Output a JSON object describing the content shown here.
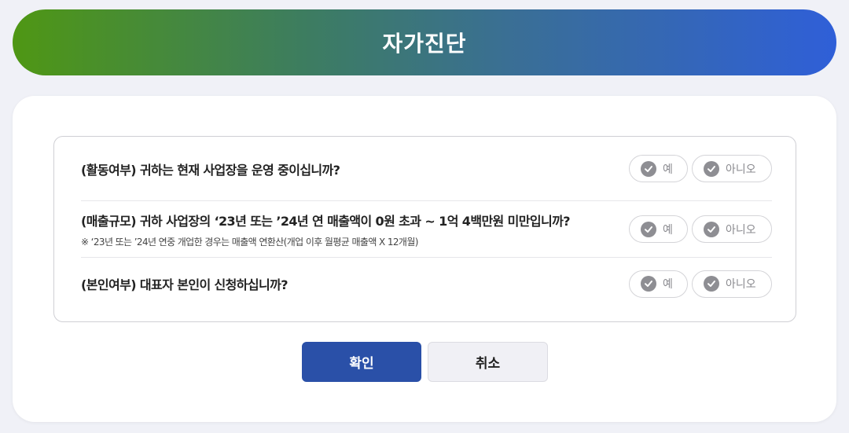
{
  "header": {
    "title": "자가진단"
  },
  "questions": [
    {
      "title": "(활동여부) 귀하는 현재 사업장을 운영 중이십니까?",
      "note": "",
      "yes_label": "예",
      "no_label": "아니오"
    },
    {
      "title": "(매출규모) 귀하 사업장의 ‘23년 또는 ’24년 연 매출액이 0원 초과 ~ 1억 4백만원 미만입니까?",
      "note": "※ ‘23년 또는 ’24년 연중 개업한 경우는 매출액 연환산(개업 이후 월평균 매출액 X 12개월)",
      "yes_label": "예",
      "no_label": "아니오"
    },
    {
      "title": "(본인여부) 대표자 본인이 신청하십니까?",
      "note": "",
      "yes_label": "예",
      "no_label": "아니오"
    }
  ],
  "buttons": {
    "confirm": "확인",
    "cancel": "취소"
  },
  "icons": {
    "option": "check-circle-icon"
  },
  "colors": {
    "header_gradient_start": "#4f9714",
    "header_gradient_end": "#2f5fd8",
    "confirm_button": "#2a50a8",
    "option_check": "#8e8e93"
  }
}
